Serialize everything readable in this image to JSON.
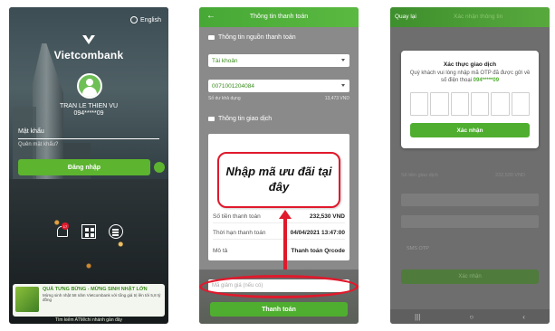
{
  "login": {
    "lang_label": "English",
    "brand": "Vietcombank",
    "user_name": "TRAN LE THIEN VU",
    "user_phone": "094*****09",
    "password_label": "Mật khẩu",
    "forgot_label": "Quên mật khẩu?",
    "login_button": "Đăng nhập",
    "notif_count": "17",
    "promo_title": "QUÀ TƯNG BỪNG - MỪNG SINH NHẬT LỚN",
    "promo_desc": "Mừng sinh nhật 58 năm Vietcombank với tổng giá trị lên tới 5,8 tỷ đồng",
    "atm_label": "Tìm kiếm ATM/chi nhánh gần đây"
  },
  "payment": {
    "title": "Thông tin thanh toán",
    "source_section": "Thông tin nguồn thanh toán",
    "account_type": "Tài khoản",
    "account_number": "0071001204084",
    "balance_label": "Số dư khả dụng",
    "balance_value": "13,473 VND",
    "tx_section": "Thông tin giao dịch",
    "rows": [
      {
        "label": "Số tiền thanh toán",
        "value": "232,530 VND"
      },
      {
        "label": "Thời hạn thanh toán",
        "value": "04/04/2021 13:47:00"
      },
      {
        "label": "Mô tả",
        "value": "Thanh toán Qrcode"
      }
    ],
    "promo_placeholder": "Mã giảm giá (nếu có)",
    "pay_button": "Thanh toán",
    "callout_text": "Nhập mã ưu đãi tại đây"
  },
  "otp": {
    "back_label": "Quay lại",
    "header_faint": "Xác nhận thông tin",
    "dim_amount_label": "Số tiền giao dịch",
    "dim_amount_value": "232,530 VND",
    "dim_otp": "SMS OTP",
    "dim_confirm": "Xác nhận",
    "modal_title": "Xác thực giao dịch",
    "modal_desc": "Quý khách vui lòng nhập mã OTP đã được gửi về số điện thoại",
    "modal_phone": "094*****09",
    "confirm_button": "Xác nhận",
    "nav": [
      "|||",
      "○",
      "‹"
    ]
  }
}
